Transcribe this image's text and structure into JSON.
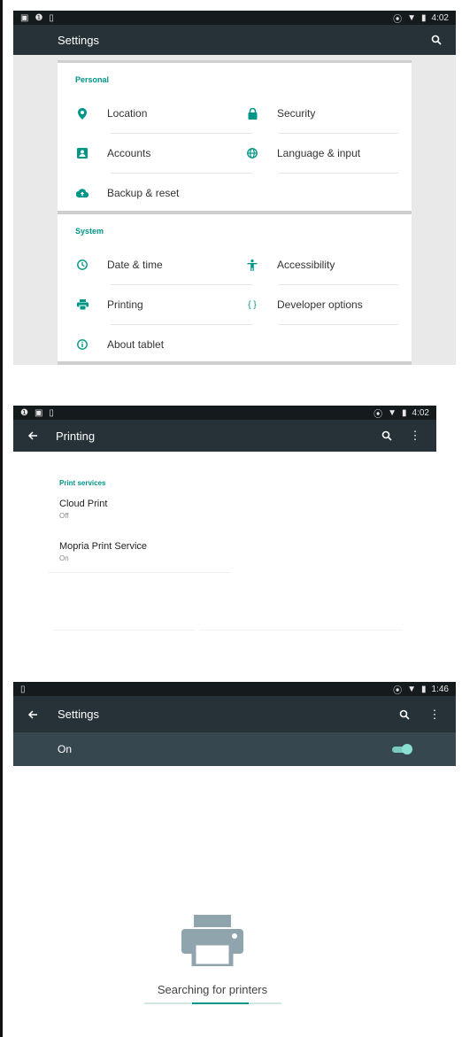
{
  "screen1": {
    "status_time": "4:02",
    "title": "Settings",
    "sections": [
      {
        "title": "Personal",
        "items": [
          {
            "label": "Location",
            "icon": "location-pin-icon"
          },
          {
            "label": "Security",
            "icon": "lock-icon"
          },
          {
            "label": "Accounts",
            "icon": "account-box-icon"
          },
          {
            "label": "Language & input",
            "icon": "globe-icon"
          },
          {
            "label": "Backup & reset",
            "icon": "cloud-upload-icon"
          }
        ]
      },
      {
        "title": "System",
        "items": [
          {
            "label": "Date & time",
            "icon": "clock-icon"
          },
          {
            "label": "Accessibility",
            "icon": "accessibility-icon"
          },
          {
            "label": "Printing",
            "icon": "printer-icon"
          },
          {
            "label": "Developer options",
            "icon": "code-braces-icon"
          },
          {
            "label": "About tablet",
            "icon": "info-icon"
          }
        ]
      }
    ]
  },
  "screen2": {
    "status_time": "4:02",
    "title": "Printing",
    "section_header": "Print services",
    "services": [
      {
        "title": "Cloud Print",
        "status": "Off"
      },
      {
        "title": "Mopria Print Service",
        "status": "On"
      }
    ]
  },
  "screen3": {
    "status_time": "1:46",
    "title": "Settings",
    "switch_label": "On",
    "switch_on": true,
    "searching_text": "Searching for printers",
    "progress_fraction": 0.41
  },
  "colors": {
    "toolbar": "#263238",
    "switchbar": "#37474f",
    "accent": "#009688"
  }
}
